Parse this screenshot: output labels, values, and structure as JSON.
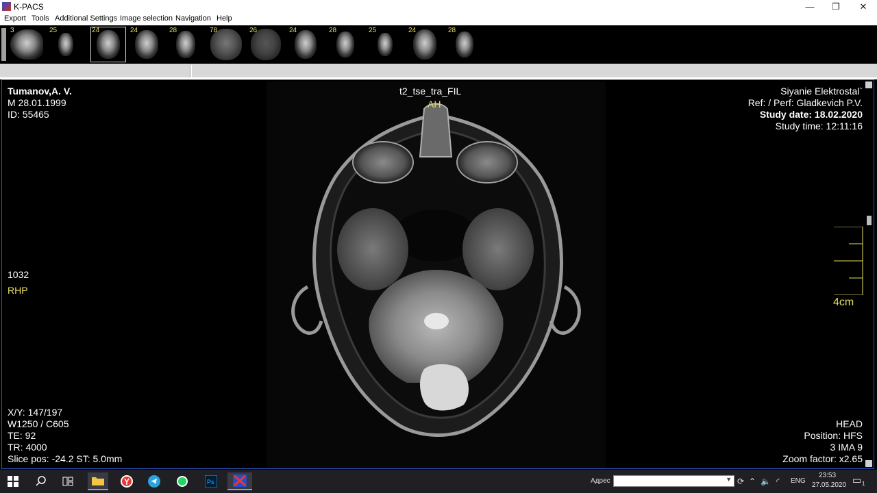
{
  "window": {
    "title": "K-PACS",
    "minimize_glyph": "—",
    "maximize_glyph": "❐",
    "close_glyph": "✕"
  },
  "menu": {
    "items": [
      "Export",
      "Tools",
      "Additional Settings",
      "Image selection",
      "Navigation",
      "Help"
    ]
  },
  "thumbnails": [
    {
      "count": "3",
      "view": "sagittal"
    },
    {
      "count": "25",
      "view": "coronal"
    },
    {
      "count": "24",
      "view": "axial",
      "selected": true
    },
    {
      "count": "24",
      "view": "axial"
    },
    {
      "count": "28",
      "view": "axial"
    },
    {
      "count": "78",
      "view": "axial"
    },
    {
      "count": "26",
      "view": "axial"
    },
    {
      "count": "24",
      "view": "axial"
    },
    {
      "count": "28",
      "view": "axial"
    },
    {
      "count": "25",
      "view": "coronal"
    },
    {
      "count": "24",
      "view": "axial"
    },
    {
      "count": "28",
      "view": "axial"
    }
  ],
  "viewer": {
    "patient_name": "Tumanov,A. V.",
    "sex_dob": "M  28.01.1999",
    "patient_id": "ID: 55465",
    "series_name": "t2_tse_tra_FIL",
    "orientation_top": "AH",
    "institution": "Siyanie Elektrostal`",
    "ref_perf": "Ref:  / Perf: Gladkevich P.V.",
    "study_date": "Study date: 18.02.2020",
    "study_time": "Study time: 12:11:16",
    "left_value": "1032",
    "orientation_left": "RHP",
    "xy": "X/Y: 147/197",
    "window_center": "W1250 / C605",
    "te": "TE: 92",
    "tr": "TR: 4000",
    "slice_pos": "Slice pos: -24.2  ST: 5.0mm",
    "body_part": "HEAD",
    "position": "Position: HFS",
    "image_index": "3 IMA 9",
    "zoom": "Zoom factor: x2.65",
    "ruler_label": "4cm",
    "overlay_color": "#e8e060",
    "border_color": "#2c55c8"
  },
  "taskbar": {
    "address_label": "Адрес",
    "language": "ENG",
    "time": "23:53",
    "date": "27.05.2020",
    "notification_count": "1",
    "apps": [
      "windows-start",
      "search",
      "task-view",
      "file-explorer",
      "yandex-browser",
      "telegram",
      "whatsapp",
      "photoshop",
      "k-pacs"
    ]
  }
}
